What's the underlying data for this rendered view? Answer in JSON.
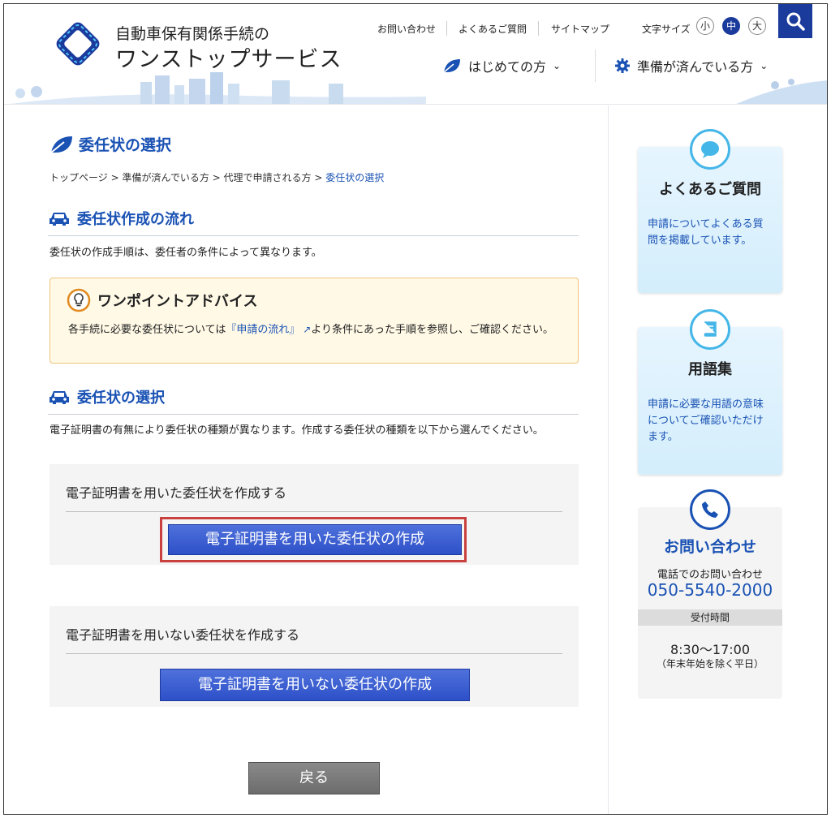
{
  "header": {
    "title_line1": "自動車保有関係手続の",
    "title_line2": "ワンストップサービス",
    "util_links": [
      "お問い合わせ",
      "よくあるご質問",
      "サイトマップ"
    ],
    "font_size_label": "文字サイズ",
    "font_sizes": [
      "小",
      "中",
      "大"
    ],
    "font_size_selected": "中",
    "nav": [
      {
        "label": "はじめての方",
        "icon": "leaf-icon"
      },
      {
        "label": "準備が済んでいる方",
        "icon": "gear-icon"
      }
    ],
    "accent_color": "#1a3a9c"
  },
  "page": {
    "title": "委任状の選択",
    "breadcrumb": [
      "トップページ",
      "準備が済んでいる方",
      "代理で申請される方",
      "委任状の選択"
    ],
    "breadcrumb_sep": " > ",
    "section1": {
      "heading": "委任状作成の流れ",
      "text": "委任状の作成手順は、委任者の条件によって異なります。"
    },
    "advice": {
      "heading": "ワンポイントアドバイス",
      "text_before": "各手続に必要な委任状については",
      "link": "『申請の流れ』",
      "text_after": "より条件にあった手順を参照し、ご確認ください。"
    },
    "section2": {
      "heading": "委任状の選択",
      "text": "電子証明書の有無により委任状の種類が異なります。作成する委任状の種類を以下から選んでください。"
    },
    "choices": [
      {
        "title": "電子証明書を用いた委任状を作成する",
        "button": "電子証明書を用いた委任状の作成",
        "highlighted": true
      },
      {
        "title": "電子証明書を用いない委任状を作成する",
        "button": "電子証明書を用いない委任状の作成",
        "highlighted": false
      }
    ],
    "back_button": "戻る"
  },
  "sidebar": {
    "faq": {
      "title": "よくあるご質問",
      "text": "申請についてよくある質問を掲載しています。",
      "icon": "chat-bubble-icon"
    },
    "glossary": {
      "title": "用語集",
      "text": "申請に必要な用語の意味についてご確認いただけます。",
      "icon": "book-icon"
    },
    "contact": {
      "title": "お問い合わせ",
      "subtitle": "電話でのお問い合わせ",
      "tel": "050-5540-2000",
      "hours_label": "受付時間",
      "hours": "8:30～17:00",
      "hours_note": "（年末年始を除く平日）",
      "icon": "phone-icon"
    }
  }
}
